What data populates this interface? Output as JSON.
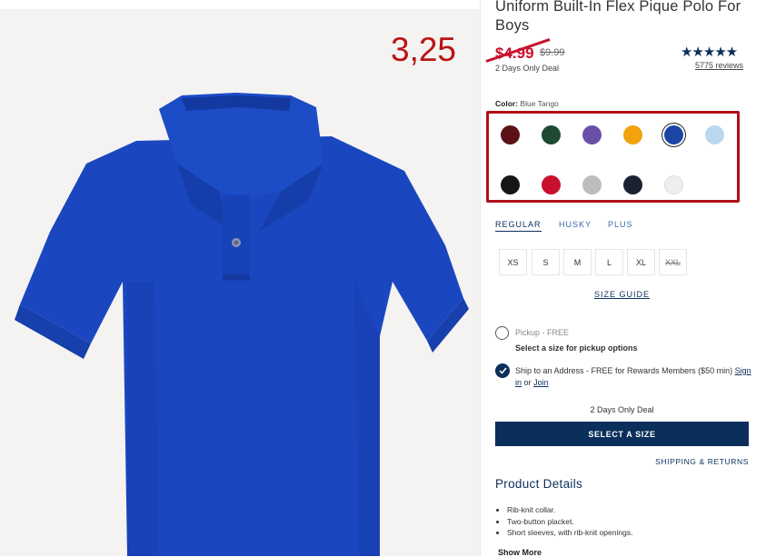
{
  "annotation": "3,25",
  "product": {
    "title": "Uniform Built-In Flex Pique Polo For Boys",
    "sale_price": "$4.99",
    "original_price": "$9.99",
    "deal_label": "2 Days Only Deal",
    "rating_stars": "★★★★★",
    "rating": 5,
    "reviews": "5775 reviews"
  },
  "color": {
    "label": "Color:",
    "selected": "Blue Tango",
    "swatches": [
      {
        "name": "burgundy",
        "hex": "#5c1118"
      },
      {
        "name": "green",
        "hex": "#1e4a33"
      },
      {
        "name": "purple",
        "hex": "#6a4fa8"
      },
      {
        "name": "orange",
        "hex": "#f2a20c"
      },
      {
        "name": "blue-tango",
        "hex": "#1c45a6",
        "selected": true
      },
      {
        "name": "light-blue",
        "hex": "#b9d8ee"
      },
      {
        "name": "black",
        "hex": "#161616"
      },
      {
        "name": "red",
        "hex": "#c8102e"
      },
      {
        "name": "heather-gray",
        "hex": "#bdbdbd"
      },
      {
        "name": "navy",
        "hex": "#1a2232"
      },
      {
        "name": "white",
        "hex": "#eeeeee"
      }
    ]
  },
  "fit_tabs": [
    "REGULAR",
    "HUSKY",
    "PLUS"
  ],
  "sizes": [
    {
      "label": "XS",
      "available": true
    },
    {
      "label": "S",
      "available": true
    },
    {
      "label": "M",
      "available": true
    },
    {
      "label": "L",
      "available": true
    },
    {
      "label": "XL",
      "available": true
    },
    {
      "label": "XXL",
      "available": false
    }
  ],
  "size_guide": "SIZE GUIDE",
  "fulfillment": {
    "pickup_label": "Pickup - FREE",
    "pickup_note": "Select a size for pickup options",
    "ship_text": "Ship to an Address - FREE for Rewards Members ($50 min)",
    "sign_in": "Sign in",
    "or": "or",
    "join": "Join"
  },
  "deal_note": "2 Days Only Deal",
  "select_button": "SELECT A SIZE",
  "shipping_returns": "SHIPPING & RETURNS",
  "details": {
    "title": "Product Details",
    "items": [
      "Rib-knit collar.",
      "Two-button placket.",
      "Short sleeves, with rib-knit openings."
    ],
    "show_more": "Show More"
  },
  "colors": {
    "accent": "#0b2f5b",
    "sale": "#c8102e",
    "annotation": "#b81414"
  }
}
